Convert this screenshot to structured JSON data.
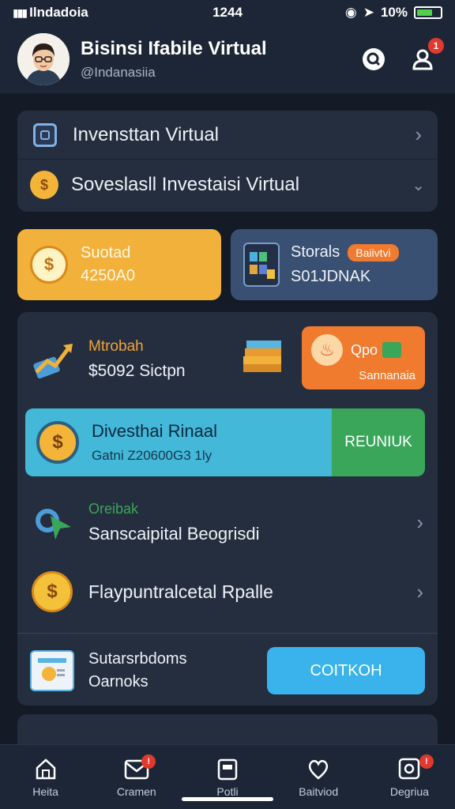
{
  "status_bar": {
    "carrier": "Ilndadoia",
    "time": "1244",
    "battery": "10%"
  },
  "header": {
    "title": "Bisinsi Ifabile Virtual",
    "subtitle": "@Indanasiia",
    "notification_count": "1"
  },
  "menu": {
    "item1": {
      "label": "Invensttan Virtual"
    },
    "item2": {
      "label": "Soveslasll Investaisi Virtual"
    }
  },
  "tiles": {
    "left": {
      "title": "Suotad",
      "value": "4250A0"
    },
    "right": {
      "title": "Storals",
      "badge": "Baiivtvi",
      "value": "S01JDNAK"
    }
  },
  "panel": {
    "promo": {
      "title": "Mtrobah",
      "value": "$5092 Sictpn"
    },
    "offer": {
      "title": "Qpo",
      "subtitle": "Sannanaia"
    },
    "banner": {
      "title": "Divesthai Rinaal",
      "subtitle": "Gatni Z20600G3 1ly",
      "button": "REUNIUK"
    },
    "row1": {
      "category": "Oreibak",
      "label": "Sanscaipital Beogrisdi"
    },
    "row2": {
      "label": "Flaypuntralcetal Rpalle"
    },
    "row3": {
      "line1": "Sutarsrbdoms",
      "line2": "Oarnoks",
      "button": "COITKOH"
    }
  },
  "bottom_nav": [
    {
      "label": "Heita",
      "icon": "home-icon"
    },
    {
      "label": "Cramen",
      "icon": "mail-icon",
      "badge": "!"
    },
    {
      "label": "Potli",
      "icon": "wallet-icon"
    },
    {
      "label": "Baitviod",
      "icon": "heart-icon"
    },
    {
      "label": "Degriua",
      "icon": "profile-icon",
      "badge": "!"
    }
  ],
  "colors": {
    "background": "#141a26",
    "card": "#252e3e",
    "orange_tile": "#f2b13b",
    "blue_tile": "#3a5072",
    "offer_tile": "#f07a2e",
    "banner": "#43b8d8",
    "green_button": "#3aa65a",
    "blue_button": "#3ab3ec"
  }
}
